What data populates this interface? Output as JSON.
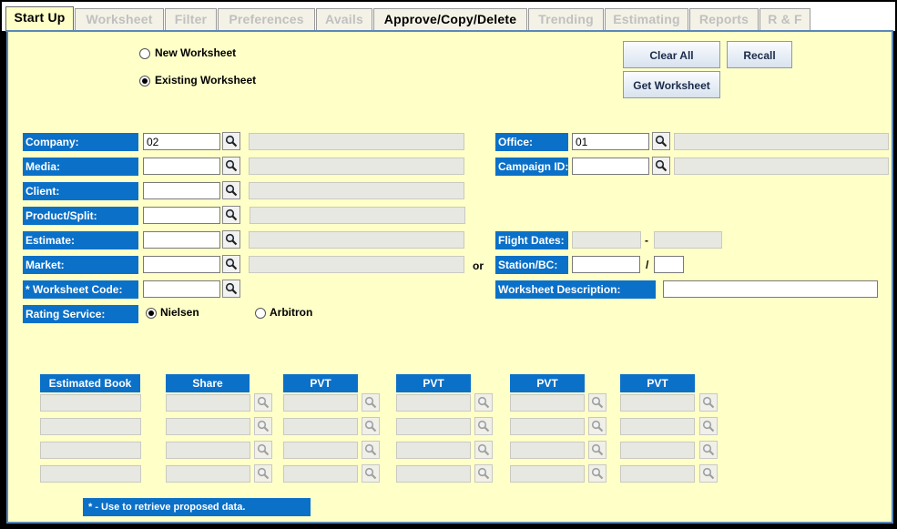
{
  "tabs": [
    {
      "label": "Start Up",
      "state": "active"
    },
    {
      "label": "Worksheet",
      "state": "disabled"
    },
    {
      "label": "Filter",
      "state": "disabled"
    },
    {
      "label": "Preferences",
      "state": "disabled"
    },
    {
      "label": "Avails",
      "state": "disabled"
    },
    {
      "label": "Approve/Copy/Delete",
      "state": "enabled"
    },
    {
      "label": "Trending",
      "state": "disabled"
    },
    {
      "label": "Estimating",
      "state": "disabled"
    },
    {
      "label": "Reports",
      "state": "disabled"
    },
    {
      "label": "R & F",
      "state": "disabled"
    }
  ],
  "mode": {
    "new_label": "New Worksheet",
    "existing_label": "Existing Worksheet",
    "selected": "existing"
  },
  "buttons": {
    "clear_all": "Clear All",
    "recall": "Recall",
    "get_worksheet": "Get Worksheet"
  },
  "left_fields": {
    "company": {
      "label": "Company:",
      "value": "02"
    },
    "media": {
      "label": "Media:",
      "value": ""
    },
    "client": {
      "label": "Client:",
      "value": ""
    },
    "product": {
      "label": "Product/Split:",
      "value": ""
    },
    "estimate": {
      "label": "Estimate:",
      "value": ""
    },
    "market": {
      "label": "Market:",
      "value": ""
    },
    "worksheet_code": {
      "label": "* Worksheet Code:",
      "value": ""
    },
    "rating_service": {
      "label": "Rating Service:"
    }
  },
  "rating_options": {
    "nielsen": "Nielsen",
    "arbitron": "Arbitron",
    "selected": "nielsen"
  },
  "or_text": "or",
  "right_fields": {
    "office": {
      "label": "Office:",
      "value": "01"
    },
    "campaign": {
      "label": "Campaign ID:",
      "value": ""
    },
    "flight_dates": {
      "label": "Flight Dates:",
      "separator": "-"
    },
    "station": {
      "label": "Station/BC:",
      "separator": "/",
      "value": "",
      "value2": ""
    },
    "ws_desc": {
      "label": "Worksheet Description:",
      "value": ""
    }
  },
  "book_grid": {
    "headers": {
      "estimated_book": "Estimated Book",
      "share": "Share",
      "pvt1": "PVT",
      "pvt2": "PVT",
      "pvt3": "PVT",
      "pvt4": "PVT"
    }
  },
  "footnote": "* - Use to retrieve proposed data.",
  "colors": {
    "accent": "#0b70c8",
    "panel": "#ffffc8",
    "border": "#5b88b7"
  },
  "icons": {
    "lookup": "magnifier-icon"
  }
}
